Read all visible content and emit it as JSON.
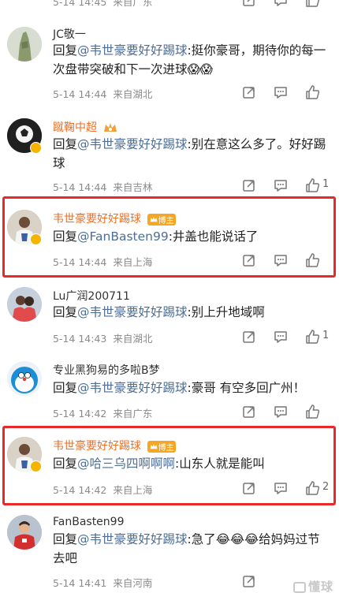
{
  "comments": [
    {
      "username": "",
      "reply_prefix": "",
      "mention": "",
      "text": "",
      "time": "5-14 14:45",
      "location": "来自广东",
      "likes": ""
    },
    {
      "username": "JC敬一",
      "reply_prefix": "回复",
      "mention": "@韦世豪要好好踢球",
      "text": ":挺你豪哥，期待你的每一次盘带突破和下一次进球😱😱",
      "time": "5-14 14:44",
      "location": "来自湖北",
      "likes": ""
    },
    {
      "username": "蹴鞠中超",
      "reply_prefix": "回复",
      "mention": "@韦世豪要好好踢球",
      "text": ":别在意这么多了。好好踢球",
      "time": "5-14 14:44",
      "location": "来自吉林",
      "likes": "1"
    },
    {
      "username": "韦世豪要好好踢球",
      "badge": "博主",
      "reply_prefix": "回复",
      "mention": "@FanBasten99",
      "text": ":井盖也能说话了",
      "time": "5-14 14:44",
      "location": "来自上海",
      "likes": ""
    },
    {
      "username": "Lu广润200711",
      "reply_prefix": "回复",
      "mention": "@韦世豪要好好踢球",
      "text": ":别上升地域啊",
      "time": "5-14 14:43",
      "location": "来自湖北",
      "likes": "1"
    },
    {
      "username": "专业黑狗易的多啦B梦",
      "reply_prefix": "回复",
      "mention": "@韦世豪要好好踢球",
      "text": ":豪哥 有空多回广州！",
      "time": "5-14 14:42",
      "location": "来自广东",
      "likes": ""
    },
    {
      "username": "韦世豪要好好踢球",
      "badge": "博主",
      "reply_prefix": "回复",
      "mention": "@哈三乌四啊啊啊",
      "text": ":山东人就是能叫",
      "time": "5-14 14:42",
      "location": "来自上海",
      "likes": "2"
    },
    {
      "username": "FanBasten99",
      "reply_prefix": "回复",
      "mention": "@韦世豪要好好踢球",
      "text": ":急了😂😂😂给妈妈过节去吧",
      "time": "5-14 14:41",
      "location": "来自河南",
      "likes": ""
    }
  ],
  "watermark": "懂球",
  "colors": {
    "mention": "#4e6e96",
    "author_name": "#e8722a",
    "highlight_box": "#e8292a",
    "meta": "#8a8a8a"
  },
  "icons": [
    "share-icon",
    "comment-icon",
    "like-icon",
    "crown-badge-icon",
    "verified-icon"
  ]
}
